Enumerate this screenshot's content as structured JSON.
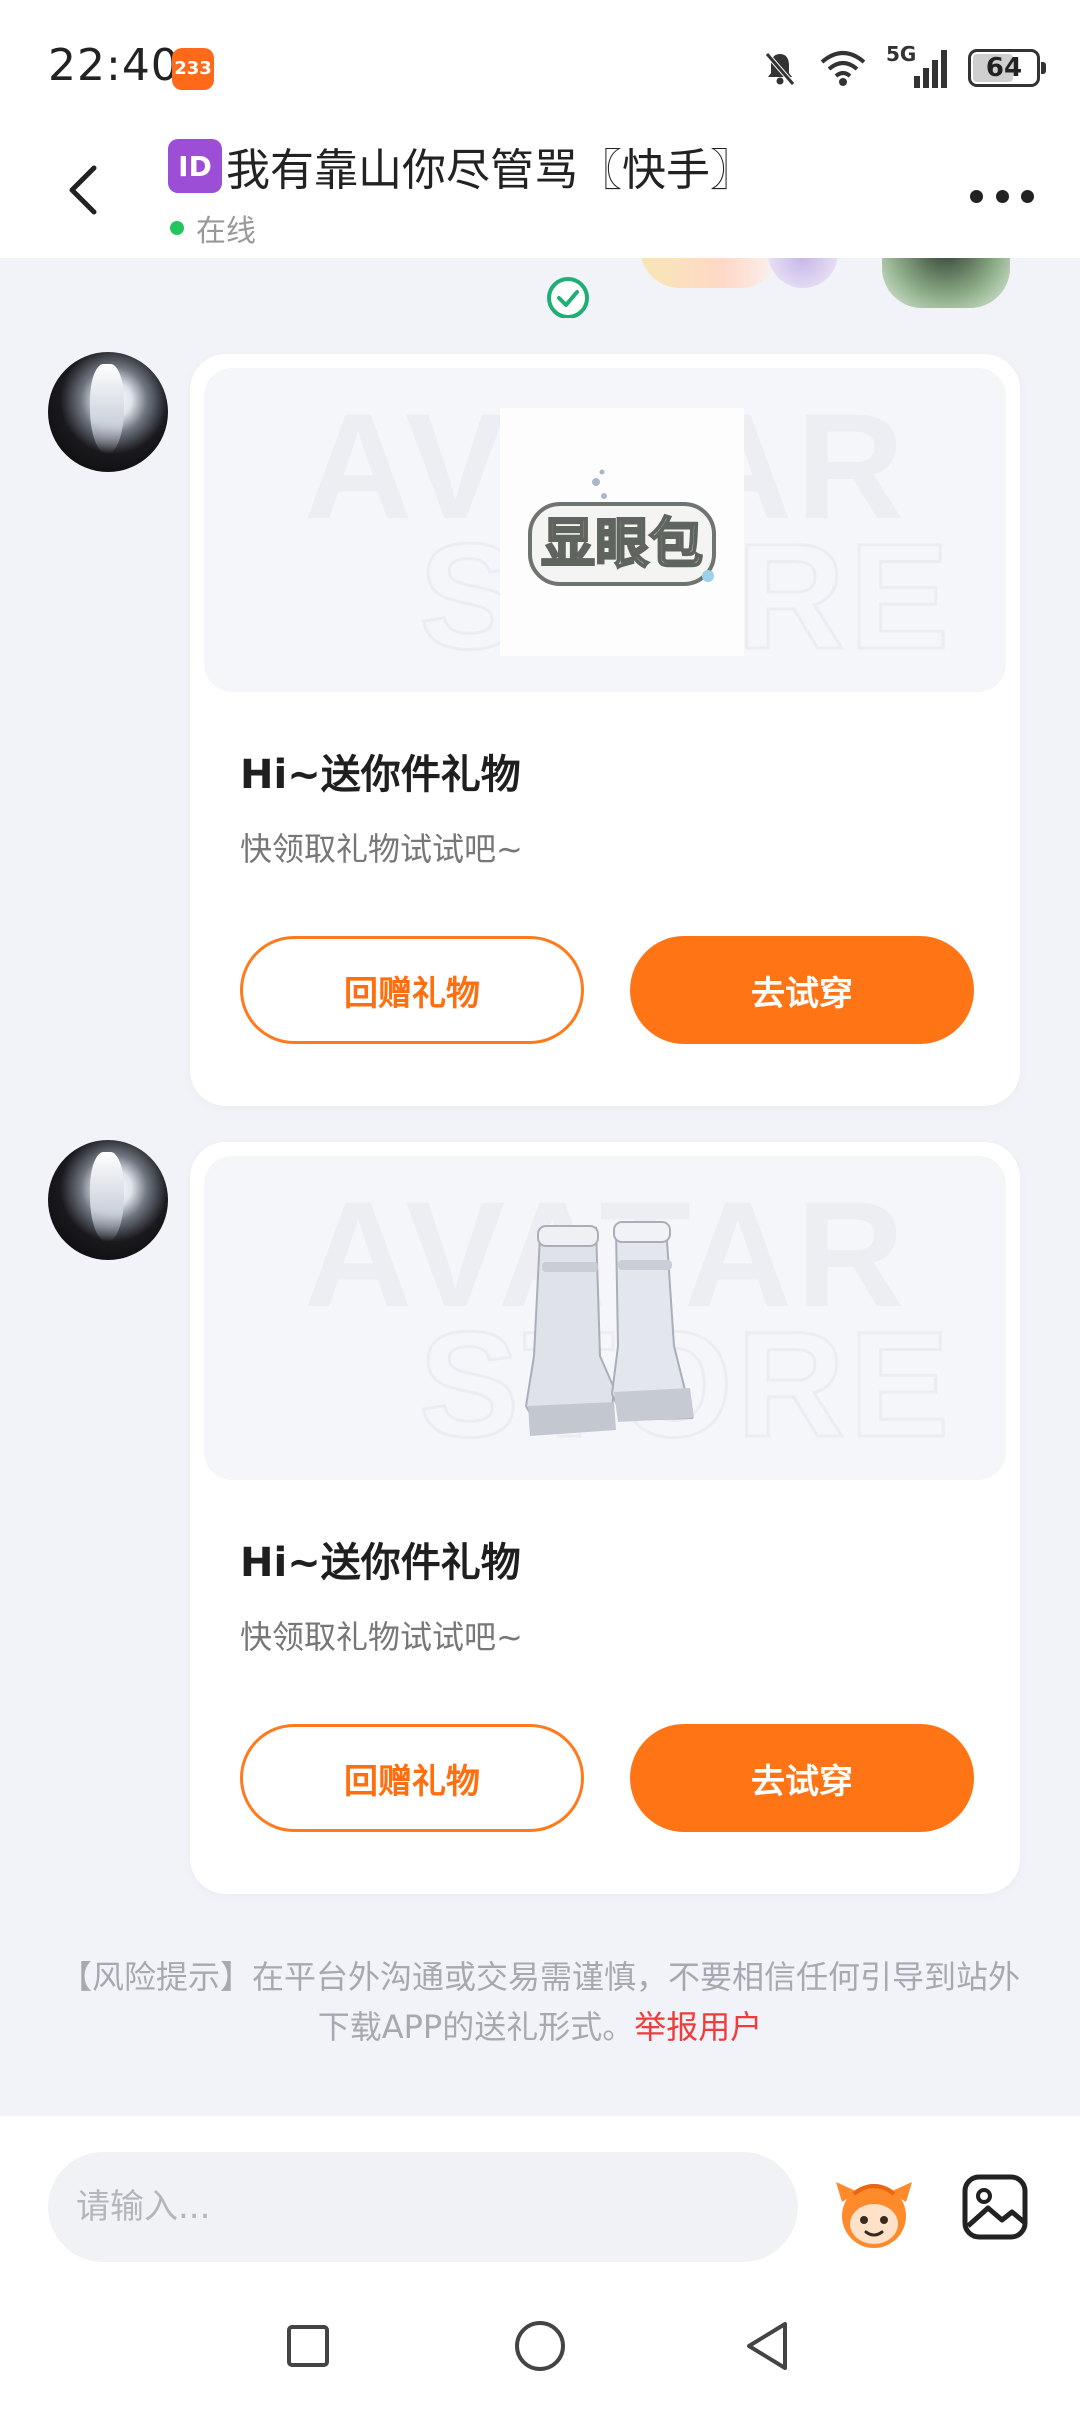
{
  "status_bar": {
    "time": "22:40",
    "app_badge": "233",
    "network": "5G",
    "battery": "64",
    "battery_level": 0.64
  },
  "header": {
    "id_badge": "ID",
    "title": "我有靠山你尽管骂〖快手〗",
    "status": "在线"
  },
  "messages": [
    {
      "gift_image": "显眼包-text-accessory",
      "title": "Hi~送你件礼物",
      "subtitle": "快领取礼物试试吧~",
      "return_label": "回赠礼物",
      "try_label": "去试穿"
    },
    {
      "gift_image": "white-boots",
      "title": "Hi~送你件礼物",
      "subtitle": "快领取礼物试试吧~",
      "return_label": "回赠礼物",
      "try_label": "去试穿"
    }
  ],
  "risk_notice": {
    "text": "【风险提示】在平台外沟通或交易需谨慎，不要相信任何引导到站外下载APP的送礼形式。",
    "link": "举报用户"
  },
  "composer": {
    "placeholder": "请输入..."
  },
  "colors": {
    "accent": "#ff7414",
    "online": "#22c55e",
    "report": "#f03c3c"
  },
  "icons": {
    "back": "chevron-left-icon",
    "more": "more-horizontal-icon",
    "verified": "check-circle-icon",
    "mascot": "mascot-emoji-icon",
    "image": "image-icon",
    "nav_recent": "square-icon",
    "nav_home": "circle-icon",
    "nav_back": "triangle-back-icon"
  }
}
